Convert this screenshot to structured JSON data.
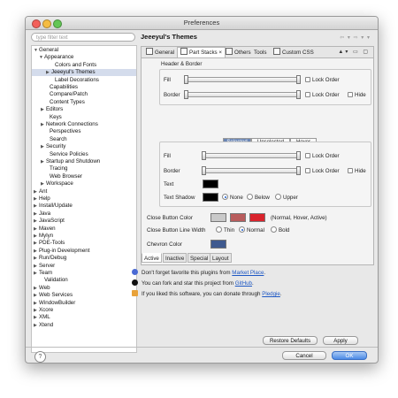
{
  "window": {
    "title": "Preferences"
  },
  "sidebar": {
    "filter_placeholder": "type filter text",
    "items": [
      {
        "label": "General",
        "arrow": "▼"
      },
      {
        "label": "Appearance",
        "arrow": "▼"
      },
      {
        "label": "Colors and Fonts",
        "arrow": ""
      },
      {
        "label": "Jeeeyul's Themes",
        "arrow": "▶"
      },
      {
        "label": "Label Decorations",
        "arrow": ""
      },
      {
        "label": "Capabilities",
        "arrow": ""
      },
      {
        "label": "Compare/Patch",
        "arrow": ""
      },
      {
        "label": "Content Types",
        "arrow": ""
      },
      {
        "label": "Editors",
        "arrow": "▶"
      },
      {
        "label": "Keys",
        "arrow": ""
      },
      {
        "label": "Network Connections",
        "arrow": "▶"
      },
      {
        "label": "Perspectives",
        "arrow": ""
      },
      {
        "label": "Search",
        "arrow": ""
      },
      {
        "label": "Security",
        "arrow": "▶"
      },
      {
        "label": "Service Policies",
        "arrow": ""
      },
      {
        "label": "Startup and Shutdown",
        "arrow": "▶"
      },
      {
        "label": "Tracing",
        "arrow": ""
      },
      {
        "label": "Web Browser",
        "arrow": ""
      },
      {
        "label": "Workspace",
        "arrow": "▶"
      },
      {
        "label": "Ant",
        "arrow": "▶"
      },
      {
        "label": "Help",
        "arrow": "▶"
      },
      {
        "label": "Install/Update",
        "arrow": "▶"
      },
      {
        "label": "Java",
        "arrow": "▶"
      },
      {
        "label": "JavaScript",
        "arrow": "▶"
      },
      {
        "label": "Maven",
        "arrow": "▶"
      },
      {
        "label": "Mylyn",
        "arrow": "▶"
      },
      {
        "label": "PDE-Tools",
        "arrow": "▶"
      },
      {
        "label": "Plug-in Development",
        "arrow": "▶"
      },
      {
        "label": "Run/Debug",
        "arrow": "▶"
      },
      {
        "label": "Server",
        "arrow": "▶"
      },
      {
        "label": "Team",
        "arrow": "▶"
      },
      {
        "label": "Validation",
        "arrow": ""
      },
      {
        "label": "Web",
        "arrow": "▶"
      },
      {
        "label": "Web Services",
        "arrow": "▶"
      },
      {
        "label": "WindowBuilder",
        "arrow": "▶"
      },
      {
        "label": "Xcore",
        "arrow": "▶"
      },
      {
        "label": "XML",
        "arrow": "▶"
      },
      {
        "label": "Xtend",
        "arrow": "▶"
      }
    ]
  },
  "panel": {
    "title": "Jeeeyul's Themes",
    "nav": "⇦ ▾ ⇨ ▾ ▾"
  },
  "tabs": {
    "general": "General",
    "part_stacks": "Part Stacks",
    "others": "Others",
    "tools": "Tools",
    "custom_css": "Custom CSS",
    "right": "▲▾ ▭ ▢"
  },
  "header_border": {
    "group_label": "Header & Border",
    "fill": "Fill",
    "border": "Border",
    "lock_order": "Lock Order",
    "hide": "Hide"
  },
  "state_tabs": {
    "selected": "Selected",
    "unselected": "Unselected",
    "hover": "Hover"
  },
  "state_panel": {
    "fill": "Fill",
    "border": "Border",
    "text": "Text",
    "text_shadow": "Text Shadow",
    "lock_order": "Lock Order",
    "hide": "Hide",
    "shadow_none": "None",
    "shadow_below": "Below",
    "shadow_upper": "Upper"
  },
  "close_button": {
    "color_label": "Close Button Color",
    "color_note": "(Normal, Hover, Active)",
    "colors": [
      "#c9c9c9",
      "#b85c5c",
      "#d9232c"
    ],
    "line_width_label": "Close Button Line Width",
    "thin": "Thin",
    "normal": "Normal",
    "bold": "Bold"
  },
  "chevron": {
    "label": "Chevron Color",
    "color": "#3f5a8f"
  },
  "bottom_tabs": [
    "Active",
    "Inactive",
    "Special",
    "Layout"
  ],
  "info": {
    "market_pre": "Don't forget favorite this plugins from ",
    "market_link": "Market Place",
    "market_post": ".",
    "github_pre": "You can fork and star this project from ",
    "github_link": "GitHub",
    "github_post": ".",
    "donate_pre": "If you liked this software, you can donate through ",
    "donate_link": "Pledgie",
    "donate_post": "."
  },
  "buttons": {
    "restore": "Restore Defaults",
    "apply": "Apply",
    "cancel": "Cancel",
    "ok": "OK",
    "help": "?"
  }
}
